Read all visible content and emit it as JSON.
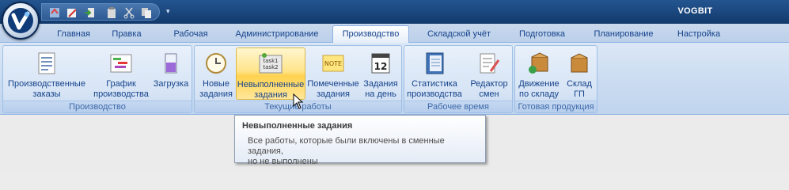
{
  "app": {
    "title": "VOGBIT"
  },
  "quick_access": {
    "icons": [
      "refresh-icon",
      "edit-icon",
      "exit-icon",
      "paste-icon",
      "cut-icon",
      "copy-icon"
    ],
    "dropdown_glyph": "▾"
  },
  "tabs": [
    {
      "label": "Главная",
      "active": false
    },
    {
      "label": "Правка",
      "active": false
    },
    {
      "label": "Рабочая",
      "active": false
    },
    {
      "label": "Администрирование",
      "active": false
    },
    {
      "label": "Производство",
      "active": true
    },
    {
      "label": "Складской учёт",
      "active": false
    },
    {
      "label": "Подготовка",
      "active": false
    },
    {
      "label": "Планирование",
      "active": false
    },
    {
      "label": "Настройка",
      "active": false
    }
  ],
  "groups": {
    "production": {
      "label": "Производство",
      "buttons": [
        {
          "line1": "Производственные",
          "line2": "заказы",
          "icon": "document-icon"
        },
        {
          "line1": "График",
          "line2": "производства",
          "icon": "gantt-chart-icon"
        },
        {
          "line1": "Загрузка",
          "line2": "",
          "icon": "beaker-icon"
        }
      ]
    },
    "current_work": {
      "label": "Текущие работы",
      "buttons": [
        {
          "line1": "Новые",
          "line2": "задания",
          "icon": "clock-icon"
        },
        {
          "line1": "Невыполненные",
          "line2": "задания",
          "icon": "task-list-icon",
          "sticker": "task1\ntask2"
        },
        {
          "line1": "Помеченные",
          "line2": "задания",
          "icon": "note-icon",
          "sticker": "NOTE"
        },
        {
          "line1": "Задания",
          "line2": "на день",
          "icon": "calendar-icon",
          "day": "12"
        }
      ]
    },
    "work_time": {
      "label": "Рабочее время",
      "buttons": [
        {
          "line1": "Статистика",
          "line2": "производства",
          "icon": "notebook-icon"
        },
        {
          "line1": "Редактор",
          "line2": "смен",
          "icon": "edit-list-icon"
        }
      ]
    },
    "finished_goods": {
      "label": "Готовая продукция",
      "buttons": [
        {
          "line1": "Движение",
          "line2": "по складу",
          "icon": "box-move-icon"
        },
        {
          "line1": "Склад",
          "line2": "ГП",
          "icon": "box-icon"
        }
      ]
    }
  },
  "tooltip": {
    "title": "Невыполненные задания",
    "line1": "Все работы, которые были включены в сменные задания,",
    "line2": "но не выполнены"
  }
}
